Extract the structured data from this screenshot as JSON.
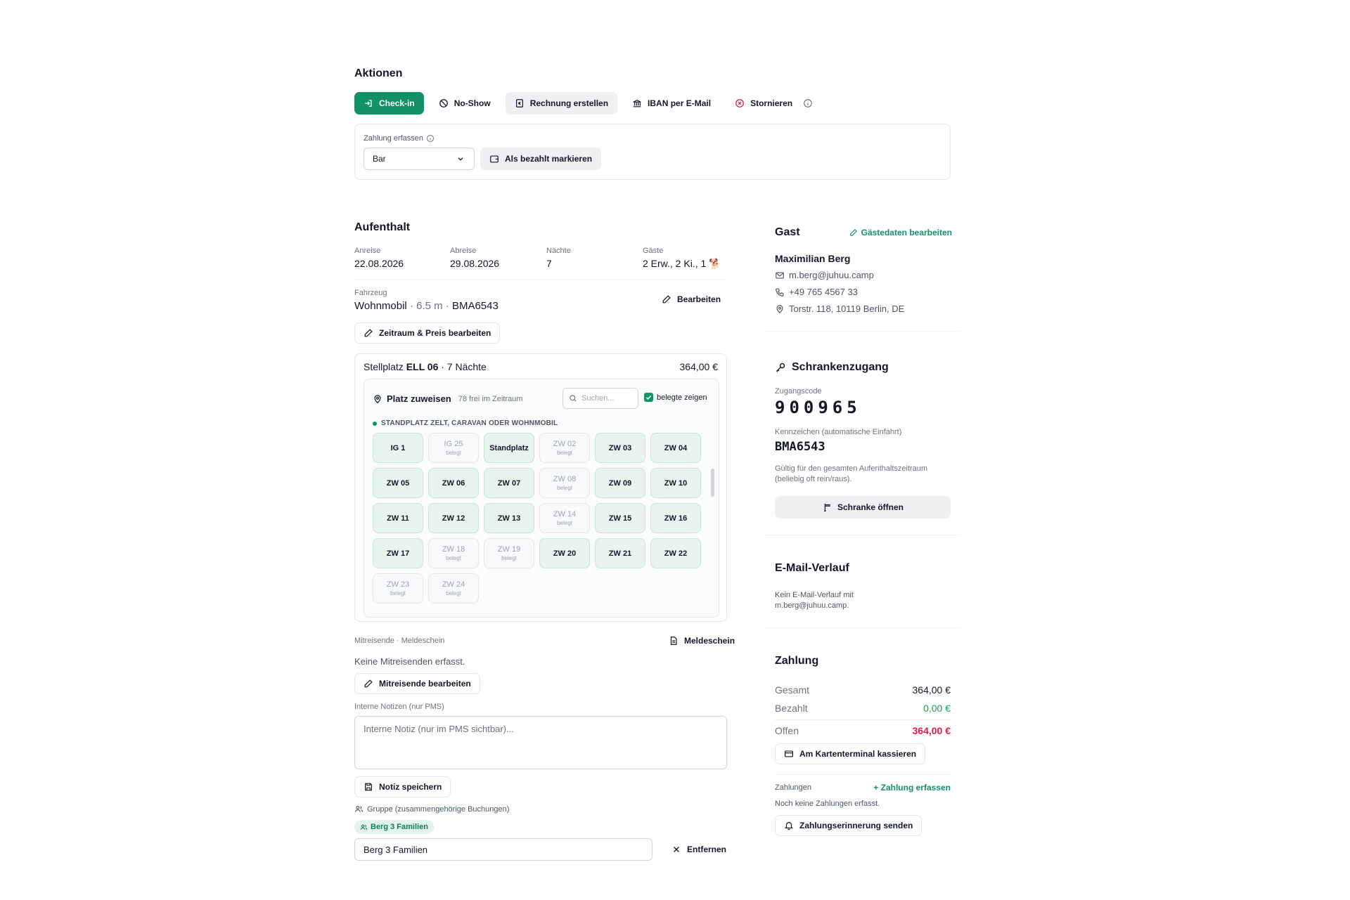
{
  "aktionen": {
    "title": "Aktionen",
    "checkin": "Check-in",
    "noshow": "No-Show",
    "invoice": "Rechnung erstellen",
    "iban": "IBAN per E-Mail",
    "cancel": "Stornieren",
    "zahlung_label": "Zahlung erfassen",
    "payment_method": "Bar",
    "paid_button": "Als bezahlt markieren"
  },
  "aufenthalt": {
    "title": "Aufenthalt",
    "anreise_label": "Anreise",
    "anreise": "22.08.2026",
    "abreise_label": "Abreise",
    "abreise": "29.08.2026",
    "naechte_label": "Nächte",
    "naechte": "7",
    "gaeste_label": "Gäste",
    "gaeste": "2 Erw., 2 Ki., 1 🐕",
    "fahrzeug_label": "Fahrzeug",
    "fahrzeug_type": "Wohnmobil",
    "fahrzeug_detail": " · 6.5 m · ",
    "fahrzeug_plate": "BMA6543",
    "edit_vehicle": "Bearbeiten",
    "edit_period": "Zeitraum & Preis bearbeiten",
    "stellplatz_prefix": "Stellplatz ",
    "stellplatz_name": "ELL 06",
    "stellplatz_suffix": " · 7 Nächte",
    "stellplatz_price": "364,00 €",
    "platz_title": "Platz zuweisen",
    "platz_free": "78 frei im Zeitraum",
    "search_placeholder": "Suchen...",
    "show_taken": "belegte zeigen",
    "category": "STANDPLATZ ZELT, CARAVAN ODER WOHNMOBIL",
    "taken_label": "belegt",
    "spots": [
      {
        "name": "IG 1",
        "taken": false
      },
      {
        "name": "IG 25",
        "taken": true
      },
      {
        "name": "Standplatz",
        "taken": false
      },
      {
        "name": "ZW 02",
        "taken": true
      },
      {
        "name": "ZW 03",
        "taken": false
      },
      {
        "name": "ZW 04",
        "taken": false
      },
      {
        "name": "ZW 05",
        "taken": false
      },
      {
        "name": "ZW 06",
        "taken": false
      },
      {
        "name": "ZW 07",
        "taken": false
      },
      {
        "name": "ZW 08",
        "taken": true
      },
      {
        "name": "ZW 09",
        "taken": false
      },
      {
        "name": "ZW 10",
        "taken": false
      },
      {
        "name": "ZW 11",
        "taken": false
      },
      {
        "name": "ZW 12",
        "taken": false
      },
      {
        "name": "ZW 13",
        "taken": false
      },
      {
        "name": "ZW 14",
        "taken": true
      },
      {
        "name": "ZW 15",
        "taken": false
      },
      {
        "name": "ZW 16",
        "taken": false
      },
      {
        "name": "ZW 17",
        "taken": false
      },
      {
        "name": "ZW 18",
        "taken": true
      },
      {
        "name": "ZW 19",
        "taken": true
      },
      {
        "name": "ZW 20",
        "taken": false
      },
      {
        "name": "ZW 21",
        "taken": false
      },
      {
        "name": "ZW 22",
        "taken": false
      },
      {
        "name": "ZW 23",
        "taken": true
      },
      {
        "name": "ZW 24",
        "taken": true
      }
    ],
    "mitreisende_label": "Mitreisende · Meldeschein",
    "meldeschein": "Meldeschein",
    "no_companions": "Keine Mitreisenden erfasst.",
    "edit_companions": "Mitreisende bearbeiten",
    "notes_label": "Interne Notizen (nur PMS)",
    "notes_placeholder": "Interne Notiz (nur im PMS sichtbar)...",
    "save_note": "Notiz speichern",
    "group_label": "Gruppe (zusammengehörige Buchungen)",
    "group_chip": "Berg 3 Familien",
    "group_value": "Berg 3 Familien",
    "remove": "Entfernen"
  },
  "gast": {
    "title": "Gast",
    "edit": "Gästedaten bearbeiten",
    "name": "Maximilian Berg",
    "email": "m.berg@juhuu.camp",
    "phone": "+49 765 4567 33",
    "address": "Torstr. 118, 10119 Berlin, DE"
  },
  "schranke": {
    "title": "Schrankenzugang",
    "code_label": "Zugangscode",
    "code": "900965",
    "plate_label": "Kennzeichen (automatische Einfahrt)",
    "plate": "BMA6543",
    "valid_note": "Gültig für den gesamten Aufenthaltszeitraum (beliebig oft rein/raus).",
    "open_button": "Schranke öffnen"
  },
  "email_verlauf": {
    "title": "E-Mail-Verlauf",
    "empty": "Kein E-Mail-Verlauf mit m.berg@juhuu.camp."
  },
  "zahlung": {
    "title": "Zahlung",
    "gesamt_label": "Gesamt",
    "gesamt": "364,00 €",
    "bezahlt_label": "Bezahlt",
    "bezahlt": "0,00 €",
    "offen_label": "Offen",
    "offen": "364,00 €",
    "terminal": "Am Kartenterminal kassieren",
    "zahlungen_label": "Zahlungen",
    "add_payment": "Zahlung erfassen",
    "no_payments": "Noch keine Zahlungen erfasst.",
    "reminder": "Zahlungserinnerung senden"
  },
  "colors": {
    "accent": "#119165",
    "danger": "#e11d48",
    "success": "#16a34a"
  }
}
